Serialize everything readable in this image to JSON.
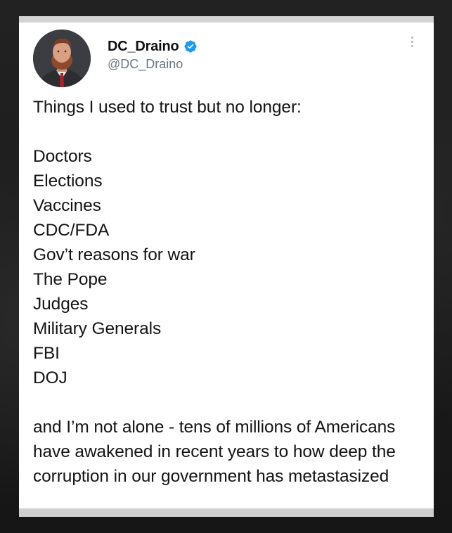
{
  "tweet": {
    "author": {
      "display_name": "DC_Draino",
      "handle": "@DC_Draino",
      "verified": true,
      "verified_icon": "verified-badge-icon",
      "avatar": "avatar-photo"
    },
    "intro": "Things I used to trust but no longer:",
    "list": [
      "Doctors",
      "Elections",
      "Vaccines",
      "CDC/FDA",
      "Gov’t reasons for war",
      "The Pope",
      "Judges",
      "Military Generals",
      "FBI",
      "DOJ"
    ],
    "outro": "and I’m not alone - tens of millions of Americans have awakened in recent years to how deep the corruption in our government has metastasized",
    "more_icon": "more-vertical-icon"
  },
  "colors": {
    "verified_blue": "#1d9bf0",
    "handle_gray": "#687684",
    "text": "#141414"
  }
}
